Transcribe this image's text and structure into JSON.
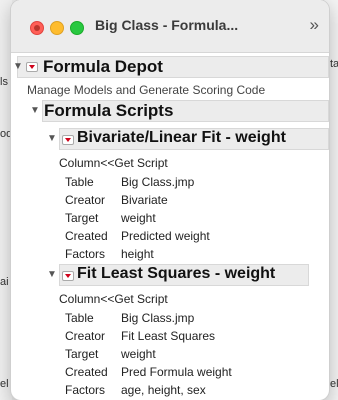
{
  "background": {
    "frag_left_1": "ls",
    "frag_left_2": "ode",
    "frag_left_3": "ai",
    "frag_left_4": "el",
    "frag_right_1": "ta",
    "frag_right_2": "el"
  },
  "window": {
    "title": "Big Class - Formula...",
    "overflow_icon": "»"
  },
  "depot": {
    "title": "Formula Depot",
    "subtitle": "Manage Models and Generate Scoring Code",
    "scripts_title": "Formula Scripts"
  },
  "models": [
    {
      "title": "Bivariate/Linear Fit - weight",
      "script_line": "Column<<Get Script",
      "rows": [
        {
          "label": "Table",
          "value": "Big Class.jmp"
        },
        {
          "label": "Creator",
          "value": "Bivariate"
        },
        {
          "label": "Target",
          "value": "weight"
        },
        {
          "label": "Created",
          "value": "Predicted weight"
        },
        {
          "label": "Factors",
          "value": "height"
        }
      ]
    },
    {
      "title": "Fit Least Squares - weight",
      "script_line": "Column<<Get Script",
      "rows": [
        {
          "label": "Table",
          "value": "Big Class.jmp"
        },
        {
          "label": "Creator",
          "value": "Fit Least Squares"
        },
        {
          "label": "Target",
          "value": "weight"
        },
        {
          "label": "Created",
          "value": "Pred Formula weight"
        },
        {
          "label": "Factors",
          "value": "age, height, sex"
        }
      ]
    }
  ],
  "colors": {
    "red_triangle": "#d0021b",
    "close": "#ff5f57",
    "minimize": "#febc2e",
    "maximize": "#28c840"
  }
}
